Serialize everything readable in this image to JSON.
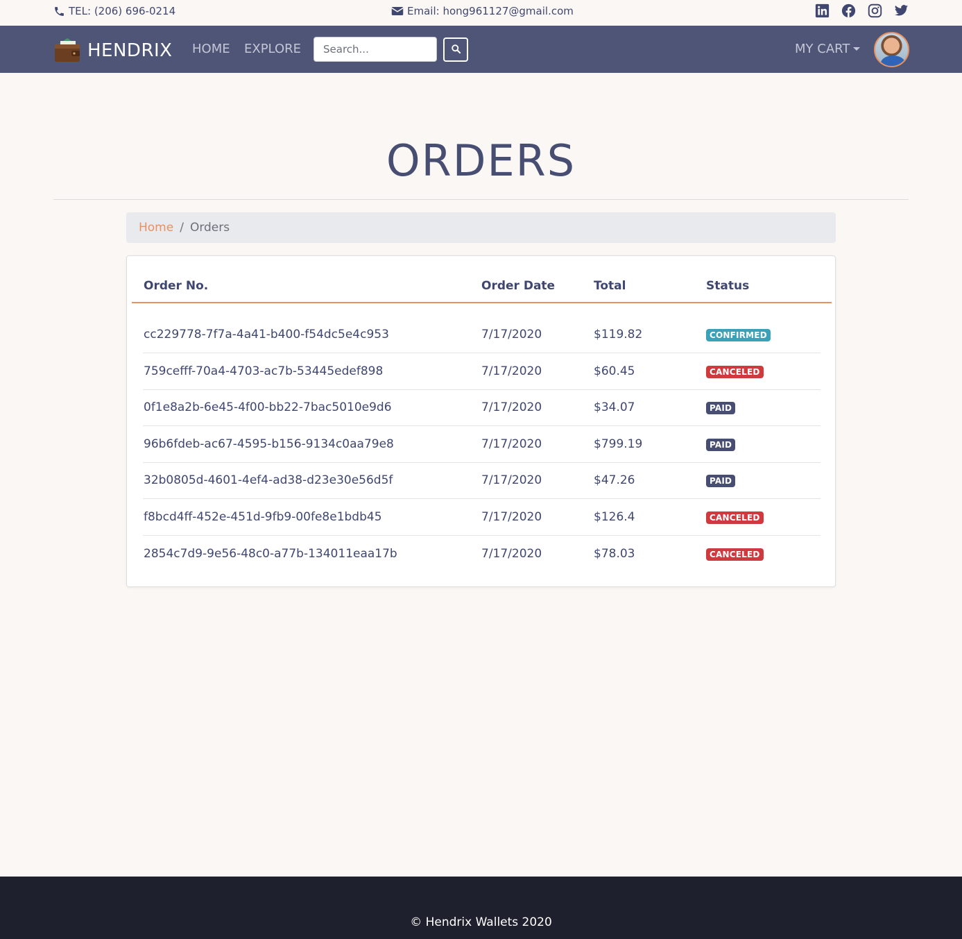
{
  "topbar": {
    "tel": "TEL: (206) 696-0214",
    "email": "Email: hong961127@gmail.com",
    "socials": [
      "linkedin-icon",
      "facebook-icon",
      "instagram-icon",
      "twitter-icon"
    ]
  },
  "navbar": {
    "brand": "HENDRIX",
    "links": [
      "HOME",
      "EXPLORE"
    ],
    "search_placeholder": "Search...",
    "cart_label": "MY CART"
  },
  "page": {
    "title": "ORDERS",
    "breadcrumb": {
      "home": "Home",
      "separator": "/",
      "current": "Orders"
    }
  },
  "orders": {
    "headers": [
      "Order No.",
      "Order Date",
      "Total",
      "Status"
    ],
    "rows": [
      {
        "id": "cc229778-7f7a-4a41-b400-f54dc5e4c953",
        "date": "7/17/2020",
        "total": "$119.82",
        "status": "CONFIRMED"
      },
      {
        "id": "759cefff-70a4-4703-ac7b-53445edef898",
        "date": "7/17/2020",
        "total": "$60.45",
        "status": "CANCELED"
      },
      {
        "id": "0f1e8a2b-6e45-4f00-bb22-7bac5010e9d6",
        "date": "7/17/2020",
        "total": "$34.07",
        "status": "PAID"
      },
      {
        "id": "96b6fdeb-ac67-4595-b156-9134c0aa79e8",
        "date": "7/17/2020",
        "total": "$799.19",
        "status": "PAID"
      },
      {
        "id": "32b0805d-4601-4ef4-ad38-d23e30e56d5f",
        "date": "7/17/2020",
        "total": "$47.26",
        "status": "PAID"
      },
      {
        "id": "f8bcd4ff-452e-451d-9fb9-00fe8e1bdb45",
        "date": "7/17/2020",
        "total": "$126.4",
        "status": "CANCELED"
      },
      {
        "id": "2854c7d9-9e56-48c0-a77b-134011eaa17b",
        "date": "7/17/2020",
        "total": "$78.03",
        "status": "CANCELED"
      }
    ]
  },
  "status_colors": {
    "CONFIRMED": "#3aa2b8",
    "CANCELED": "#cf3a3f",
    "PAID": "#474e72"
  },
  "colors": {
    "accent": "#e8915f",
    "nav": "#4f5577",
    "footer": "#1e202d"
  },
  "footer": {
    "text": "© Hendrix Wallets 2020"
  }
}
